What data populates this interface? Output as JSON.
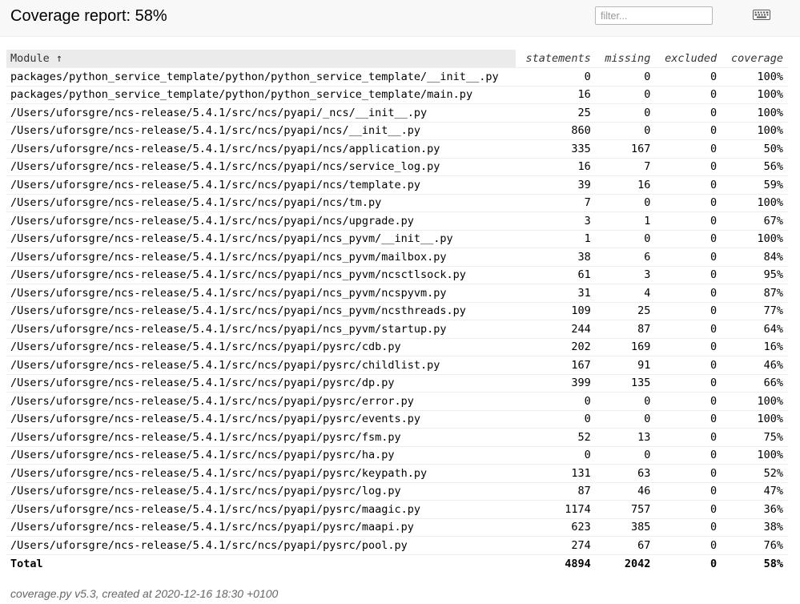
{
  "header": {
    "title": "Coverage report: 58%",
    "filter_placeholder": "filter...",
    "keyboard_icon": "keyboard-icon"
  },
  "table": {
    "columns": [
      "Module ↑",
      "statements",
      "missing",
      "excluded",
      "coverage"
    ],
    "rows": [
      {
        "module": "packages/python_service_template/python/python_service_template/__init__.py",
        "statements": "0",
        "missing": "0",
        "excluded": "0",
        "coverage": "100%"
      },
      {
        "module": "packages/python_service_template/python/python_service_template/main.py",
        "statements": "16",
        "missing": "0",
        "excluded": "0",
        "coverage": "100%"
      },
      {
        "module": "/Users/uforsgre/ncs-release/5.4.1/src/ncs/pyapi/_ncs/__init__.py",
        "statements": "25",
        "missing": "0",
        "excluded": "0",
        "coverage": "100%"
      },
      {
        "module": "/Users/uforsgre/ncs-release/5.4.1/src/ncs/pyapi/ncs/__init__.py",
        "statements": "860",
        "missing": "0",
        "excluded": "0",
        "coverage": "100%"
      },
      {
        "module": "/Users/uforsgre/ncs-release/5.4.1/src/ncs/pyapi/ncs/application.py",
        "statements": "335",
        "missing": "167",
        "excluded": "0",
        "coverage": "50%"
      },
      {
        "module": "/Users/uforsgre/ncs-release/5.4.1/src/ncs/pyapi/ncs/service_log.py",
        "statements": "16",
        "missing": "7",
        "excluded": "0",
        "coverage": "56%"
      },
      {
        "module": "/Users/uforsgre/ncs-release/5.4.1/src/ncs/pyapi/ncs/template.py",
        "statements": "39",
        "missing": "16",
        "excluded": "0",
        "coverage": "59%"
      },
      {
        "module": "/Users/uforsgre/ncs-release/5.4.1/src/ncs/pyapi/ncs/tm.py",
        "statements": "7",
        "missing": "0",
        "excluded": "0",
        "coverage": "100%"
      },
      {
        "module": "/Users/uforsgre/ncs-release/5.4.1/src/ncs/pyapi/ncs/upgrade.py",
        "statements": "3",
        "missing": "1",
        "excluded": "0",
        "coverage": "67%"
      },
      {
        "module": "/Users/uforsgre/ncs-release/5.4.1/src/ncs/pyapi/ncs_pyvm/__init__.py",
        "statements": "1",
        "missing": "0",
        "excluded": "0",
        "coverage": "100%"
      },
      {
        "module": "/Users/uforsgre/ncs-release/5.4.1/src/ncs/pyapi/ncs_pyvm/mailbox.py",
        "statements": "38",
        "missing": "6",
        "excluded": "0",
        "coverage": "84%"
      },
      {
        "module": "/Users/uforsgre/ncs-release/5.4.1/src/ncs/pyapi/ncs_pyvm/ncsctlsock.py",
        "statements": "61",
        "missing": "3",
        "excluded": "0",
        "coverage": "95%"
      },
      {
        "module": "/Users/uforsgre/ncs-release/5.4.1/src/ncs/pyapi/ncs_pyvm/ncspyvm.py",
        "statements": "31",
        "missing": "4",
        "excluded": "0",
        "coverage": "87%"
      },
      {
        "module": "/Users/uforsgre/ncs-release/5.4.1/src/ncs/pyapi/ncs_pyvm/ncsthreads.py",
        "statements": "109",
        "missing": "25",
        "excluded": "0",
        "coverage": "77%"
      },
      {
        "module": "/Users/uforsgre/ncs-release/5.4.1/src/ncs/pyapi/ncs_pyvm/startup.py",
        "statements": "244",
        "missing": "87",
        "excluded": "0",
        "coverage": "64%"
      },
      {
        "module": "/Users/uforsgre/ncs-release/5.4.1/src/ncs/pyapi/pysrc/cdb.py",
        "statements": "202",
        "missing": "169",
        "excluded": "0",
        "coverage": "16%"
      },
      {
        "module": "/Users/uforsgre/ncs-release/5.4.1/src/ncs/pyapi/pysrc/childlist.py",
        "statements": "167",
        "missing": "91",
        "excluded": "0",
        "coverage": "46%"
      },
      {
        "module": "/Users/uforsgre/ncs-release/5.4.1/src/ncs/pyapi/pysrc/dp.py",
        "statements": "399",
        "missing": "135",
        "excluded": "0",
        "coverage": "66%"
      },
      {
        "module": "/Users/uforsgre/ncs-release/5.4.1/src/ncs/pyapi/pysrc/error.py",
        "statements": "0",
        "missing": "0",
        "excluded": "0",
        "coverage": "100%"
      },
      {
        "module": "/Users/uforsgre/ncs-release/5.4.1/src/ncs/pyapi/pysrc/events.py",
        "statements": "0",
        "missing": "0",
        "excluded": "0",
        "coverage": "100%"
      },
      {
        "module": "/Users/uforsgre/ncs-release/5.4.1/src/ncs/pyapi/pysrc/fsm.py",
        "statements": "52",
        "missing": "13",
        "excluded": "0",
        "coverage": "75%"
      },
      {
        "module": "/Users/uforsgre/ncs-release/5.4.1/src/ncs/pyapi/pysrc/ha.py",
        "statements": "0",
        "missing": "0",
        "excluded": "0",
        "coverage": "100%"
      },
      {
        "module": "/Users/uforsgre/ncs-release/5.4.1/src/ncs/pyapi/pysrc/keypath.py",
        "statements": "131",
        "missing": "63",
        "excluded": "0",
        "coverage": "52%"
      },
      {
        "module": "/Users/uforsgre/ncs-release/5.4.1/src/ncs/pyapi/pysrc/log.py",
        "statements": "87",
        "missing": "46",
        "excluded": "0",
        "coverage": "47%"
      },
      {
        "module": "/Users/uforsgre/ncs-release/5.4.1/src/ncs/pyapi/pysrc/maagic.py",
        "statements": "1174",
        "missing": "757",
        "excluded": "0",
        "coverage": "36%"
      },
      {
        "module": "/Users/uforsgre/ncs-release/5.4.1/src/ncs/pyapi/pysrc/maapi.py",
        "statements": "623",
        "missing": "385",
        "excluded": "0",
        "coverage": "38%"
      },
      {
        "module": "/Users/uforsgre/ncs-release/5.4.1/src/ncs/pyapi/pysrc/pool.py",
        "statements": "274",
        "missing": "67",
        "excluded": "0",
        "coverage": "76%"
      }
    ],
    "total": {
      "label": "Total",
      "statements": "4894",
      "missing": "2042",
      "excluded": "0",
      "coverage": "58%"
    }
  },
  "footer": {
    "text": "coverage.py v5.3, created at 2020-12-16 18:30 +0100"
  }
}
